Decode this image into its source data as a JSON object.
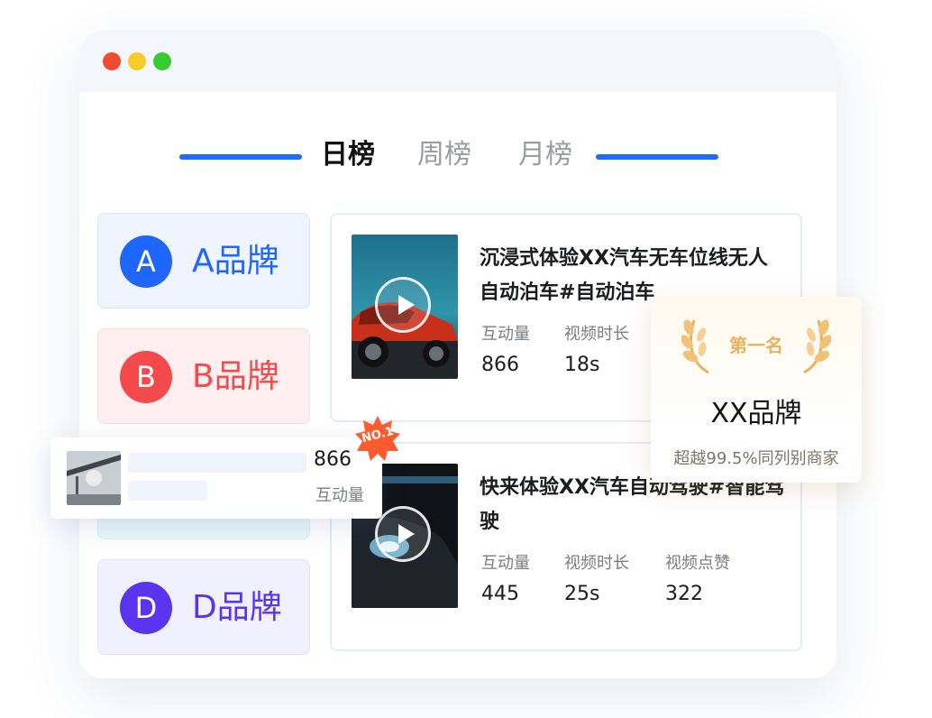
{
  "window": {
    "controls": [
      "close",
      "minimize",
      "maximize"
    ],
    "tabs": [
      {
        "label": "日榜",
        "active": true
      },
      {
        "label": "周榜",
        "active": false
      },
      {
        "label": "月榜",
        "active": false
      }
    ],
    "accent_color": "#1f6bff"
  },
  "brands": [
    {
      "initial": "A",
      "name": "A品牌",
      "color": "#1f66ff"
    },
    {
      "initial": "B",
      "name": "B品牌",
      "color": "#f44a4c"
    },
    {
      "initial": "D",
      "name": "D品牌",
      "color": "#5a35f0"
    }
  ],
  "videos": [
    {
      "title": "沉浸式体验XX汽车无车位线无人自动泊车#自动泊车",
      "stats": [
        {
          "label": "互动量",
          "value": "866"
        },
        {
          "label": "视频时长",
          "value": "18s"
        }
      ],
      "thumbnail_icon": "play-icon"
    },
    {
      "title": "快来体验XX汽车自动驾驶#智能驾驶",
      "stats": [
        {
          "label": "互动量",
          "value": "445"
        },
        {
          "label": "视频时长",
          "value": "25s"
        },
        {
          "label": "视频点赞",
          "value": "322"
        }
      ],
      "thumbnail_icon": "play-icon"
    }
  ],
  "award": {
    "rank": "第一名",
    "brand": "XX品牌",
    "exceed": "超越99.5%同列别商家",
    "icon": "laurel-icon",
    "color": "#e8b25c"
  },
  "popup": {
    "value": "866",
    "label": "互动量",
    "badge": "NO.1",
    "badge_color": "#ff5b2e"
  }
}
